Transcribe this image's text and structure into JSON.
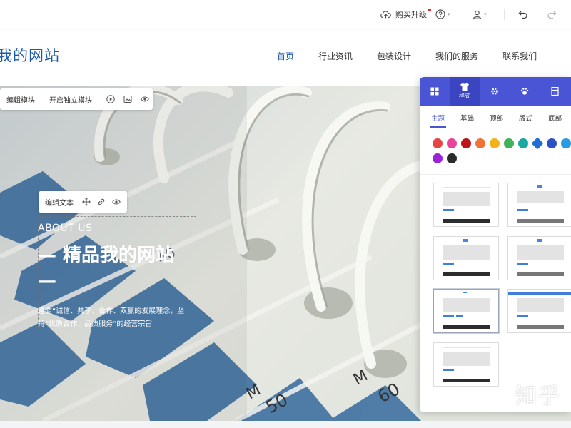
{
  "toolbar": {
    "upgrade_label": "购买升级",
    "icons": [
      "cloud-upload-icon",
      "help-icon",
      "user-icon",
      "undo-icon",
      "redo-icon"
    ]
  },
  "site": {
    "title": "我的网站",
    "nav": [
      "首页",
      "行业资讯",
      "包装设计",
      "我们的服务",
      "联系我们"
    ],
    "active_nav": "首页"
  },
  "module_toolbar": {
    "edit_module_label": "编辑模块",
    "independent_edit_label": "开启独立模块",
    "icons": [
      "play-icon",
      "image-icon",
      "eye-icon"
    ]
  },
  "text_toolbar": {
    "edit_text_label": "编辑文本",
    "icons": [
      "move-icon",
      "link-icon",
      "eye-icon"
    ]
  },
  "hero": {
    "kicker": "ABOUT US",
    "heading": "— 精品我的网站 —",
    "description": "遵循“诚信、共享、合作、双赢的发展理念，坚持”优质合作，品质服务“的经营宗旨"
  },
  "style_panel": {
    "tabs": [
      {
        "icon": "grid-icon",
        "label": ""
      },
      {
        "icon": "shirt-icon",
        "label": "样式"
      },
      {
        "icon": "gear-icon",
        "label": ""
      },
      {
        "icon": "paw-icon",
        "label": ""
      },
      {
        "icon": "layout-icon",
        "label": ""
      }
    ],
    "active_tab": "样式",
    "subtabs": [
      "主题",
      "基础",
      "顶部",
      "版式",
      "底部"
    ],
    "active_subtab": "主题",
    "swatch_colors": [
      "#e64545",
      "#e8449b",
      "#c0141b",
      "#f07335",
      "#f2b21a",
      "#3db35a",
      "#19a9a0",
      "#1e6fd8",
      "#2b52c4",
      "#2a9be0",
      "#9b23d8",
      "#2b2b2b"
    ]
  },
  "watermark": "知乎"
}
